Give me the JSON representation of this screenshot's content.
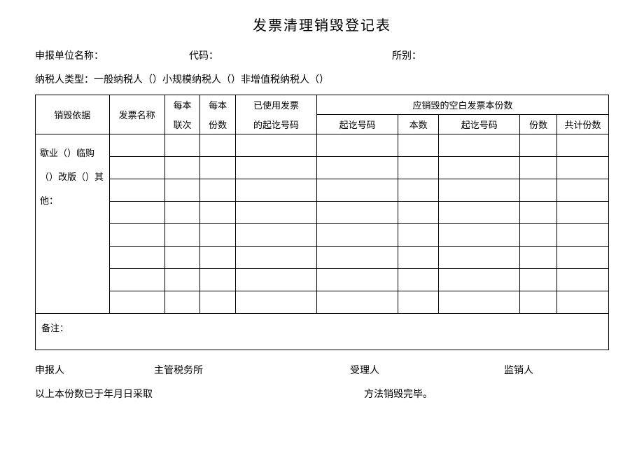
{
  "title": "发票清理销毁登记表",
  "meta": {
    "unit_label": "申报单位名称：",
    "code_label": "代码：",
    "office_label": "所别：",
    "taxpayer_type_label": "纳税人类型：一般纳税人（）小规模纳税人（）非增值税纳税人（）"
  },
  "headers": {
    "basis": "销毁依据",
    "invoice_name": "发票名称",
    "copies_per_book_l1": "每本",
    "copies_per_book_l2": "联次",
    "count_per_book_l1": "每本",
    "count_per_book_l2": "份数",
    "used_range_l1": "已使用发票",
    "used_range_l2": "的起讫号码",
    "blank_group": "应销毁的空白发票本份数",
    "blank_range1": "起讫号码",
    "blank_books": "本数",
    "blank_range2": "起讫号码",
    "blank_copies": "份数",
    "blank_total": "共计份数"
  },
  "basis_text": "歇业（）临购（）改版（）其他：",
  "remark_label": "备注：",
  "footer": {
    "reporter": "申报人",
    "tax_office": "主管税务所",
    "acceptor": "受理人",
    "supervisor": "监销人",
    "note_left": "以上本份数已于年月日采取",
    "note_right": "方法销毁完毕。"
  }
}
